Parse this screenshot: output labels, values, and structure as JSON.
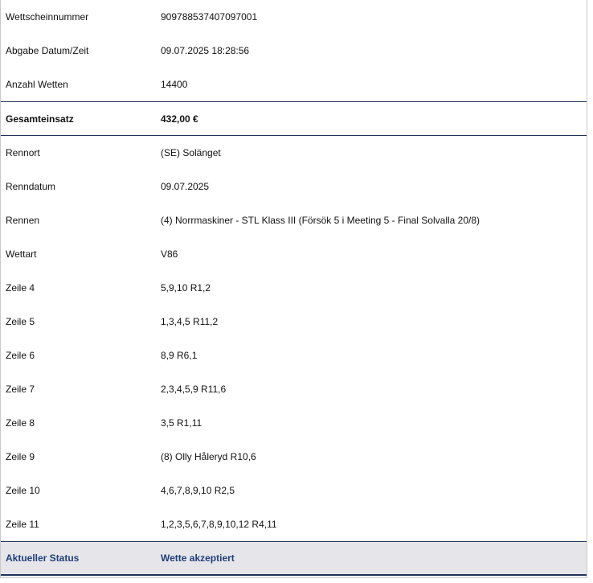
{
  "header_rows": [
    {
      "label": "Wettscheinnummer",
      "value": "909788537407097001"
    },
    {
      "label": "Abgabe Datum/Zeit",
      "value": "09.07.2025 18:28:56"
    },
    {
      "label": "Anzahl Wetten",
      "value": "14400"
    }
  ],
  "total": {
    "label": "Gesamteinsatz",
    "value": "432,00 €"
  },
  "detail_rows": [
    {
      "label": "Rennort",
      "value": "(SE) Solänget"
    },
    {
      "label": "Renndatum",
      "value": "09.07.2025"
    },
    {
      "label": "Rennen",
      "value": "(4) Norrmaskiner - STL Klass III (Försök 5 i Meeting 5 - Final Solvalla 20/8)"
    },
    {
      "label": "Wettart",
      "value": "V86"
    },
    {
      "label": "Zeile 4",
      "value": "5,9,10 R1,2"
    },
    {
      "label": "Zeile 5",
      "value": "1,3,4,5 R11,2"
    },
    {
      "label": "Zeile 6",
      "value": "8,9 R6,1"
    },
    {
      "label": "Zeile 7",
      "value": "2,3,4,5,9 R11,6"
    },
    {
      "label": "Zeile 8",
      "value": "3,5 R1,11"
    },
    {
      "label": "Zeile 9",
      "value": "(8) Olly Håleryd R10,6"
    },
    {
      "label": "Zeile 10",
      "value": "4,6,7,8,9,10 R2,5"
    },
    {
      "label": "Zeile 11",
      "value": "1,2,3,5,6,7,8,9,10,12 R4,11"
    }
  ],
  "status": {
    "label": "Aktueller Status",
    "value": "Wette akzeptiert"
  },
  "colors": {
    "accent": "#1f3f79",
    "divider": "#1f3358",
    "status_background": "#e6e6ea"
  }
}
